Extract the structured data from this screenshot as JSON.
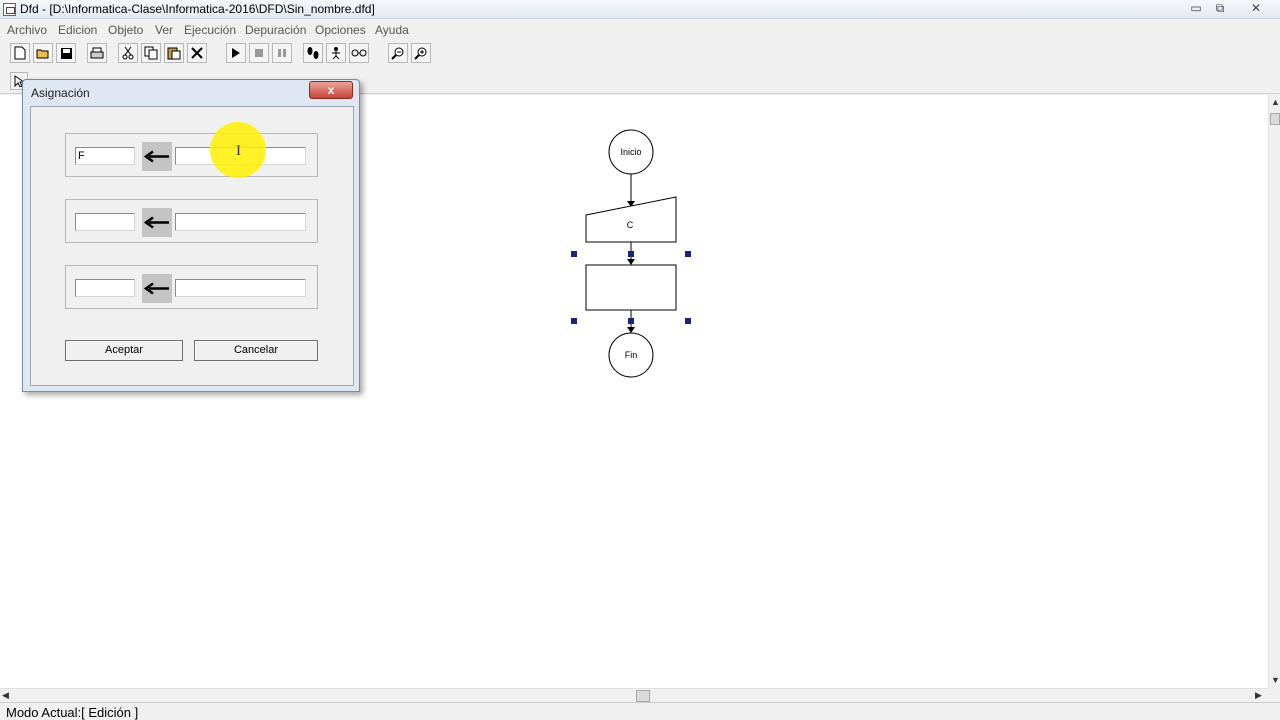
{
  "window": {
    "title": "Dfd - [D:\\Informatica-Clase\\Informatica-2016\\DFD\\Sin_nombre.dfd]",
    "minimize_glyph": "▭",
    "restore_glyph": "⧉",
    "close_glyph": "✕"
  },
  "menu": {
    "items": [
      "Archivo",
      "Edicion",
      "Objeto",
      "Ver",
      "Ejecución",
      "Depuración",
      "Opciones",
      "Ayuda"
    ]
  },
  "toolbar": {
    "icons": [
      "new-icon",
      "open-icon",
      "save-icon",
      "print-icon",
      "cut-icon",
      "copy-icon",
      "paste-icon",
      "delete-icon",
      "run-icon",
      "stop-icon",
      "pause-icon",
      "step-icon",
      "step-into-icon",
      "watch-icon",
      "zoom-out-icon",
      "zoom-in-icon"
    ]
  },
  "flowchart": {
    "start_label": "Inicio",
    "read_label": "C",
    "end_label": "Fin"
  },
  "dialog": {
    "title": "Asignación",
    "close_glyph": "x",
    "rows": [
      {
        "variable": "F",
        "expression": ""
      },
      {
        "variable": "",
        "expression": ""
      },
      {
        "variable": "",
        "expression": ""
      }
    ],
    "accept_label": "Aceptar",
    "cancel_label": "Cancelar"
  },
  "cursor": {
    "glyph": "I"
  },
  "status": {
    "text": "Modo Actual:[ Edición ]"
  },
  "colors": {
    "selection_handle": "#1a237e",
    "highlight": "#fff000",
    "dialog_close": "#c7453a"
  }
}
